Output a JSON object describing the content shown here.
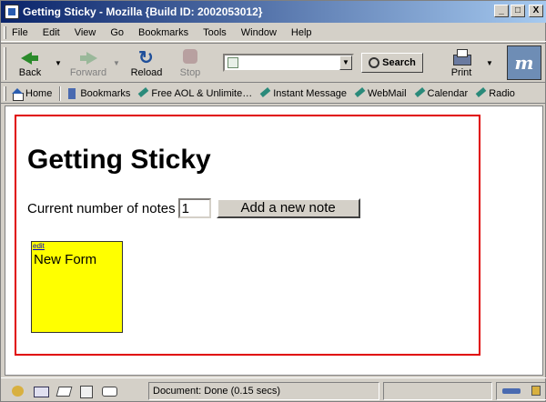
{
  "window": {
    "title": "Getting Sticky - Mozilla {Build ID: 2002053012}",
    "controls": {
      "minimize": "_",
      "maximize": "□",
      "close": "X"
    }
  },
  "menu": {
    "items": [
      "File",
      "Edit",
      "View",
      "Go",
      "Bookmarks",
      "Tools",
      "Window",
      "Help"
    ]
  },
  "nav_toolbar": {
    "back_label": "Back",
    "forward_label": "Forward",
    "reload_label": "Reload",
    "stop_label": "Stop",
    "search_label": "Search",
    "print_label": "Print",
    "url_value": "",
    "drop_arrow": "▼",
    "logo_text": "m"
  },
  "personal_toolbar": {
    "items": [
      "Home",
      "Bookmarks",
      "Free AOL & Unlimite…",
      "Instant Message",
      "WebMail",
      "Calendar",
      "Radio"
    ]
  },
  "page": {
    "heading": "Getting Sticky",
    "count_label": "Current number of notes",
    "count_value": "1",
    "add_button_label": "Add a new note",
    "notes": [
      {
        "edit_label": "edit",
        "text": "New Form",
        "color": "#ffff00"
      }
    ],
    "border_color": "#e00000"
  },
  "status": {
    "text": "Document: Done (0.15 secs)"
  }
}
